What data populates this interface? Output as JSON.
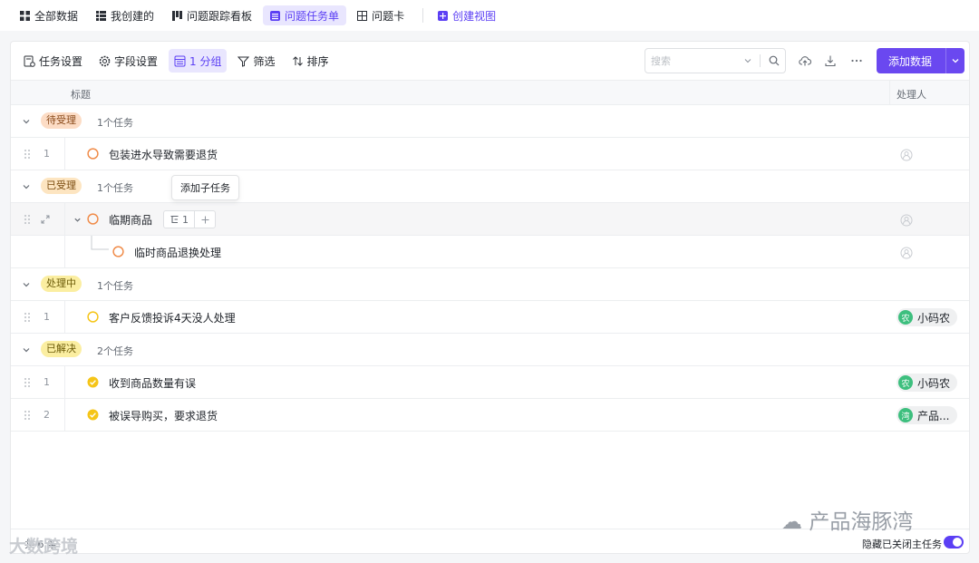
{
  "top_tabs": [
    {
      "label": "全部数据",
      "icon": "grid-icon"
    },
    {
      "label": "我创建的",
      "icon": "list-icon"
    },
    {
      "label": "问题跟踪看板",
      "icon": "kanban-icon"
    },
    {
      "label": "问题任务单",
      "icon": "table-icon",
      "active": true
    },
    {
      "label": "问题卡",
      "icon": "card-icon"
    }
  ],
  "create_view": "创建视图",
  "toolbar": {
    "task_settings": "任务设置",
    "field_settings": "字段设置",
    "group": "1 分组",
    "filter": "筛选",
    "sort": "排序",
    "search_placeholder": "搜索",
    "add_data": "添加数据"
  },
  "columns": {
    "title": "标题",
    "assignee": "处理人"
  },
  "tooltip": "添加子任务",
  "groups": [
    {
      "label": "待受理",
      "count": "1个任务",
      "tag_bg": "#fcdcc5",
      "tag_fg": "#8a4a1a",
      "tasks": [
        {
          "num": "1",
          "title": "包装进水导致需要退货",
          "status": "todo-orange",
          "assignee": ""
        }
      ]
    },
    {
      "label": "已受理",
      "count": "1个任务",
      "tag_bg": "#fde5c1",
      "tag_fg": "#7a4b0e",
      "tasks": [
        {
          "num": "",
          "title": "临期商品",
          "status": "todo-orange",
          "assignee": "",
          "subtasks": "1",
          "children": [
            {
              "title": "临时商品退换处理",
              "status": "todo-orange"
            }
          ]
        }
      ]
    },
    {
      "label": "处理中",
      "count": "1个任务",
      "tag_bg": "#fbeea1",
      "tag_fg": "#6b5a07",
      "tasks": [
        {
          "num": "1",
          "title": "客户反馈投诉4天没人处理",
          "status": "todo-yellow",
          "assignee": "小码农",
          "avatar": "农"
        }
      ]
    },
    {
      "label": "已解决",
      "count": "2个任务",
      "tag_bg": "#fbeea1",
      "tag_fg": "#6b5a07",
      "tasks": [
        {
          "num": "1",
          "title": "收到商品数量有误",
          "status": "done",
          "assignee": "小码农",
          "avatar": "农"
        },
        {
          "num": "2",
          "title": "被误导购买，要求退货",
          "status": "done",
          "assignee": "产品...",
          "avatar": "湾"
        }
      ]
    }
  ],
  "footer": {
    "count": "共 6 条",
    "hide_closed": "隐藏已关闭主任务",
    "toggle_on": true
  },
  "watermark": {
    "right": "产品海豚湾",
    "left": "大数跨境"
  },
  "colors": {
    "accent": "#5b3ff4",
    "primary_btn": "#6a48f0",
    "orange": "#f08c4a",
    "yellow": "#f5c518"
  }
}
